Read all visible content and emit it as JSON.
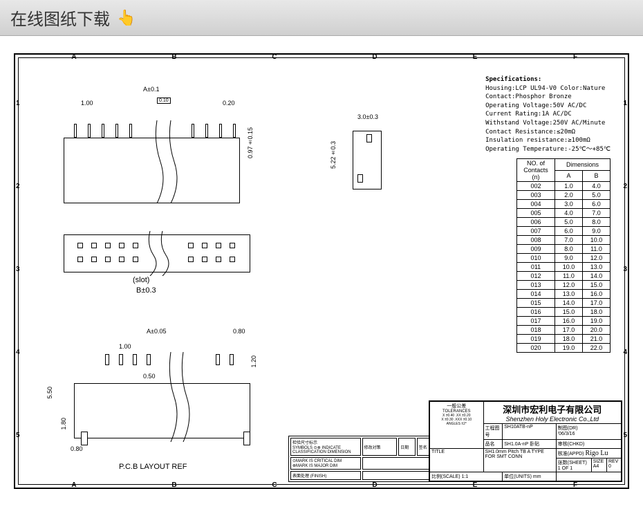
{
  "top_bar": {
    "title": "在线图纸下载",
    "icon": "👆"
  },
  "grid": {
    "cols": [
      "A",
      "B",
      "C",
      "D",
      "E",
      "F"
    ],
    "rows": [
      "1",
      "2",
      "3",
      "4",
      "5"
    ]
  },
  "specs": {
    "title": "Specifications:",
    "lines": [
      "Housing:LCP UL94-V0 Color:Nature",
      "Contact:Phosphor Bronze",
      "Operating Voltage:50V AC/DC",
      "Current Rating:1A AC/DC",
      "Withstand Voltage:250V AC/Minute",
      "Contact Resistance:≤20mΩ",
      "Insulation resistance:≥100mΩ",
      "Operating Temperature:-25℃～+85℃"
    ]
  },
  "dim_table": {
    "hdr_no": "NO. of Contacts (n)",
    "hdr_dim": "Dimensions",
    "hdr_a": "A",
    "hdr_b": "B",
    "rows": [
      {
        "n": "002",
        "a": "1.0",
        "b": "4.0"
      },
      {
        "n": "003",
        "a": "2.0",
        "b": "5.0"
      },
      {
        "n": "004",
        "a": "3.0",
        "b": "6.0"
      },
      {
        "n": "005",
        "a": "4.0",
        "b": "7.0"
      },
      {
        "n": "006",
        "a": "5.0",
        "b": "8.0"
      },
      {
        "n": "007",
        "a": "6.0",
        "b": "9.0"
      },
      {
        "n": "008",
        "a": "7.0",
        "b": "10.0"
      },
      {
        "n": "009",
        "a": "8.0",
        "b": "11.0"
      },
      {
        "n": "010",
        "a": "9.0",
        "b": "12.0"
      },
      {
        "n": "011",
        "a": "10.0",
        "b": "13.0"
      },
      {
        "n": "012",
        "a": "11.0",
        "b": "14.0"
      },
      {
        "n": "013",
        "a": "12.0",
        "b": "15.0"
      },
      {
        "n": "014",
        "a": "13.0",
        "b": "16.0"
      },
      {
        "n": "015",
        "a": "14.0",
        "b": "17.0"
      },
      {
        "n": "016",
        "a": "15.0",
        "b": "18.0"
      },
      {
        "n": "017",
        "a": "16.0",
        "b": "19.0"
      },
      {
        "n": "018",
        "a": "17.0",
        "b": "20.0"
      },
      {
        "n": "019",
        "a": "18.0",
        "b": "21.0"
      },
      {
        "n": "020",
        "a": "19.0",
        "b": "22.0"
      }
    ]
  },
  "views": {
    "v1": {
      "dim_a": "A±0.1",
      "dim_pitch": "1.00",
      "dim_box": "0.10",
      "dim_lead": "0.20",
      "dim_h": "0.97±0.15"
    },
    "v2": {
      "dim_w": "3.0±0.3",
      "dim_h": "5.22±0.3"
    },
    "v3": {
      "slot_label": "(slot)",
      "dim_b": "B±0.3"
    },
    "v4": {
      "dim_a": "A±0.05",
      "dim_pitch": "1.00",
      "dim_pad_w": "0.50",
      "dim_pad_end": "0.80",
      "dim_h1": "5.50",
      "dim_h2": "1.80",
      "dim_h3": "1.20",
      "dim_end": "0.80",
      "label": "P.C.B LAYOUT REF"
    }
  },
  "title_block": {
    "tol_title": "一般公差",
    "tol_sub": "TOLERANCES",
    "tol_x": "X ±0.40  .XX ±0.20",
    "tol_x2": "X ±0.30  .XXX ±0.10",
    "tol_ang": "ANGLES ±2°",
    "company_cn": "深圳市宏利电子有限公司",
    "company_en": "Shenzhen Holy Electronic Co.,Ltd",
    "part_lbl": "品名",
    "part_val": "SH1.0A-nP 卧贴",
    "draw_lbl": "工程图号",
    "draw_val": "SH10ATB-nP",
    "title_lbl": "TITLE",
    "title_val": "SH1.0mm Pitch TB A TYPE FOR SMT CONN",
    "date_lbl": "制图(DR)",
    "date_val": "'06/3/16",
    "chk_lbl": "审核(CHKD)",
    "appd_lbl": "核准(APPD)",
    "sign": "Rigo Lu",
    "scale_lbl": "比例(SCALE)",
    "scale_val": "1:1",
    "unit_lbl": "单位(UNITS)",
    "unit_val": "mm",
    "sheet_lbl": "张数(SHEET)",
    "sheet_val": "1 OF 1",
    "size_lbl": "SIZE",
    "size_val": "A4",
    "rev_lbl": "REV",
    "rev_val": "0"
  },
  "mark_notes": {
    "insp": "检验尺寸标示",
    "insp_sub": "SYMBOLS ⊙⊗ INDICATE CLASSIFICATION DIMENSION",
    "crit": "⊙MARK IS CRITICAL DIM",
    "major": "⊗MARK IS MAJOR DIM",
    "surf_lbl": "表面处理",
    "surf_sub": "(FINISH)",
    "mod_lbl": "修改对策",
    "mod_date": "日期",
    "mod_sign": "签名"
  }
}
